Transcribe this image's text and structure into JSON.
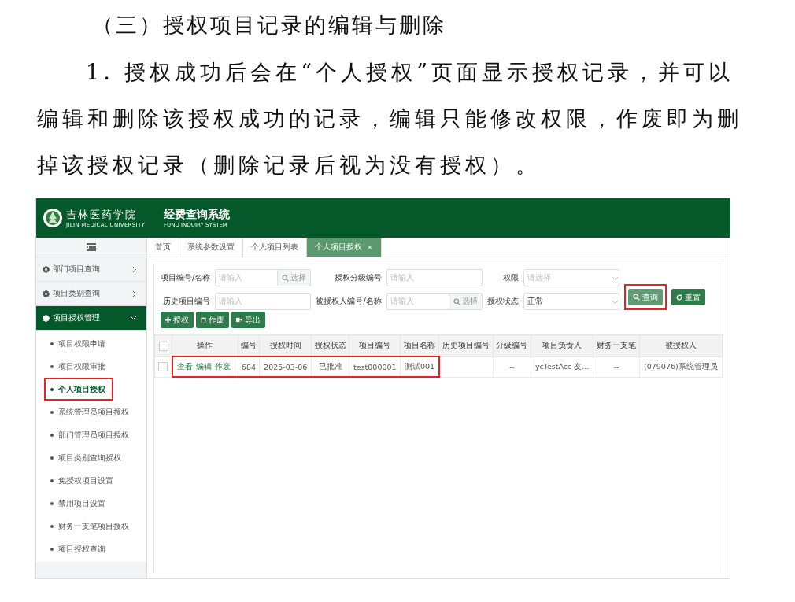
{
  "document": {
    "heading": "（三）授权项目记录的编辑与删除",
    "paragraph": "1. 授权成功后会在“个人授权”页面显示授权记录，并可以编辑和删除该授权成功的记录，编辑只能修改权限，作废即为删掉该授权记录（删除记录后视为没有授权）。"
  },
  "app": {
    "header": {
      "logo_text": "吉林医药学院",
      "logo_subtext": "JILIN MEDICAL UNIVERSITY",
      "title": "经费查询系统",
      "subtitle": "FUND INQUIRY SYSTEM"
    },
    "sidebar": {
      "items": [
        {
          "label": "部门项目查询",
          "expanded": false,
          "selected": false
        },
        {
          "label": "项目类别查询",
          "expanded": false,
          "selected": false
        },
        {
          "label": "项目授权管理",
          "expanded": true,
          "selected": true,
          "children": [
            {
              "label": "项目权限申请",
              "selected": false,
              "highlighted": false
            },
            {
              "label": "项目权限审批",
              "selected": false,
              "highlighted": false
            },
            {
              "label": "个人项目授权",
              "selected": true,
              "highlighted": true
            },
            {
              "label": "系统管理员项目授权",
              "selected": false,
              "highlighted": false
            },
            {
              "label": "部门管理员项目授权",
              "selected": false,
              "highlighted": false
            },
            {
              "label": "项目类别查询授权",
              "selected": false,
              "highlighted": false
            },
            {
              "label": "免授权项目设置",
              "selected": false,
              "highlighted": false
            },
            {
              "label": "禁用项目设置",
              "selected": false,
              "highlighted": false
            },
            {
              "label": "财务一支笔项目授权",
              "selected": false,
              "highlighted": false
            },
            {
              "label": "项目授权查询",
              "selected": false,
              "highlighted": false
            }
          ]
        }
      ]
    },
    "tabs": [
      {
        "label": "首页",
        "selected": false
      },
      {
        "label": "系统参数设置",
        "selected": false
      },
      {
        "label": "个人项目列表",
        "selected": false
      },
      {
        "label": "个人项目授权",
        "selected": true,
        "close": "×"
      }
    ],
    "filters": [
      {
        "kind": "picker",
        "label": "项目编号/名称",
        "placeholder": "请输入",
        "button": "选择"
      },
      {
        "kind": "text",
        "label": "授权分级编号",
        "placeholder": "请输入"
      },
      {
        "kind": "select",
        "label": "权限",
        "placeholder": "请选择"
      },
      {
        "kind": "text",
        "label": "历史项目编号",
        "placeholder": "请输入"
      },
      {
        "kind": "picker",
        "label": "被授权人编号/名称",
        "placeholder": "请输入",
        "button": "选择"
      },
      {
        "kind": "select",
        "label": "授权状态",
        "value": "正常"
      }
    ],
    "actions": [
      {
        "kind": "search",
        "label": "查询",
        "highlighted": true
      },
      {
        "kind": "reset",
        "label": "重置",
        "highlighted": false
      }
    ],
    "toolbar": [
      {
        "kind": "add",
        "label": "授权"
      },
      {
        "kind": "void",
        "label": "作废"
      },
      {
        "kind": "export",
        "label": "导出"
      }
    ],
    "table": {
      "all_selected": false,
      "columns": [
        "操作",
        "编号",
        "授权时间",
        "授权状态",
        "项目编号",
        "项目名称",
        "历史项目编号",
        "分级编号",
        "项目负责人",
        "财务一支笔",
        "被授权人"
      ],
      "rows": [
        {
          "selected": false,
          "cells": [
            {
              "kind": "actions",
              "actions": [
                "查看",
                "编辑",
                "作废"
              ],
              "highlighted": true
            },
            {
              "text": "684",
              "highlighted": true
            },
            {
              "text": "2025-03-06",
              "highlighted": true
            },
            {
              "text": "已批准",
              "highlighted": true
            },
            {
              "text": "test000001",
              "highlighted": true
            },
            {
              "text": "测试001",
              "highlighted": true
            },
            {
              "text": "",
              "highlighted": false
            },
            {
              "text": "--",
              "highlighted": false
            },
            {
              "text": "ycTestAcc 友...",
              "highlighted": false
            },
            {
              "text": "--",
              "highlighted": false
            },
            {
              "text": "(079076)系统管理员",
              "highlighted": false
            }
          ]
        }
      ]
    }
  }
}
